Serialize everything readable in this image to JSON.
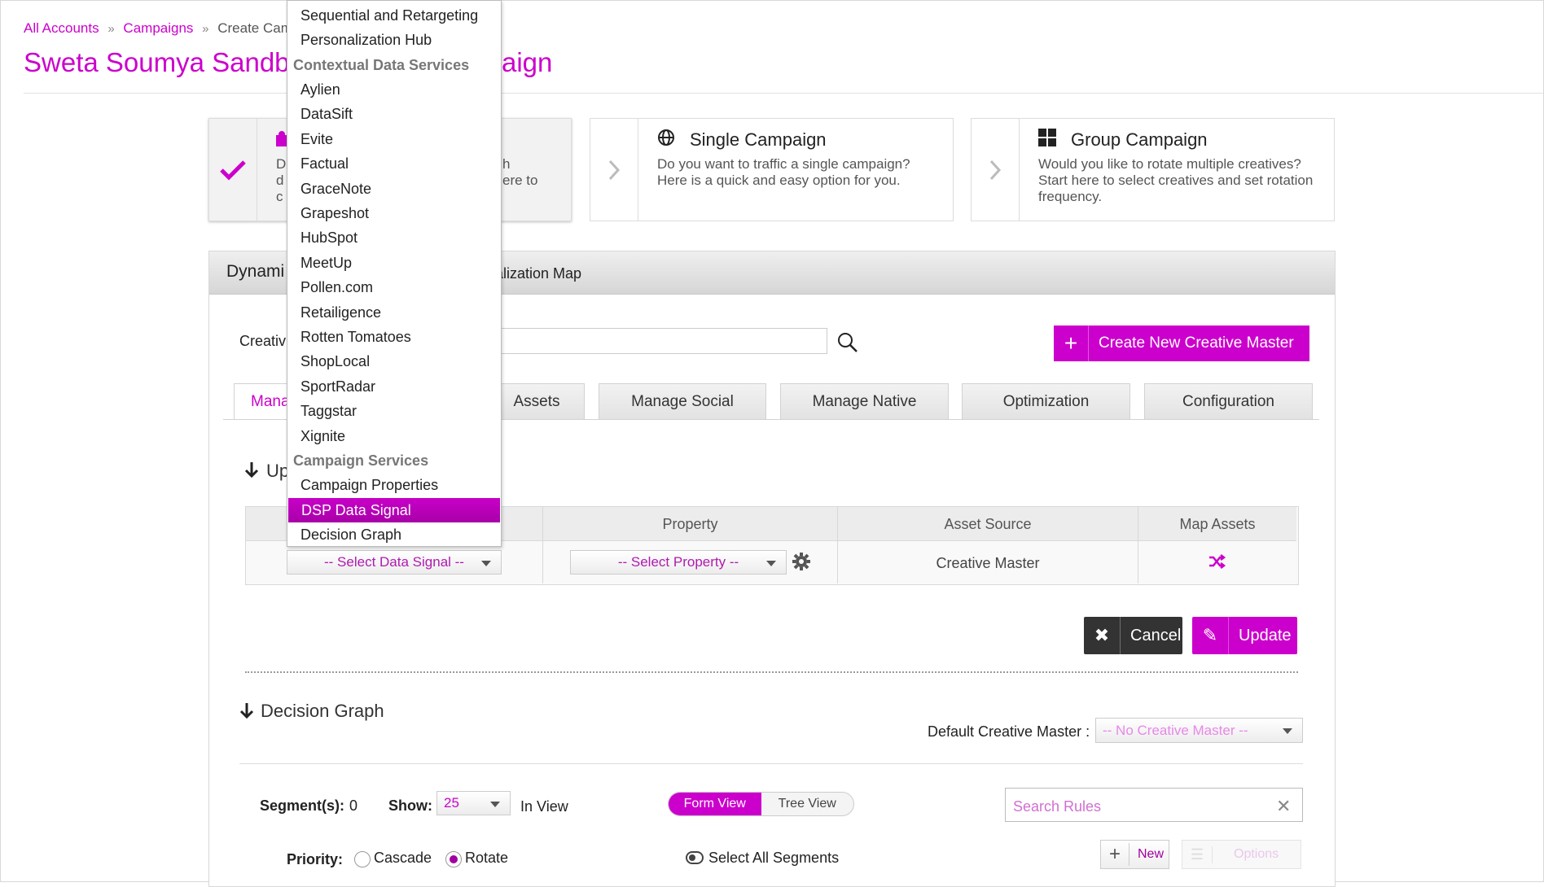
{
  "breadcrumb": {
    "items": [
      "All Accounts",
      "Campaigns",
      "Create Camp"
    ],
    "separator": "»"
  },
  "page": {
    "title_left": "Sweta Soumya Sandb",
    "title_right": "aign"
  },
  "cards": [
    {
      "title": "",
      "desc_left": [
        "D",
        "d",
        "c"
      ],
      "desc_right": [
        "h",
        "ere to",
        ""
      ],
      "icon": "puzzle-icon",
      "state": "checked"
    },
    {
      "title": "Single Campaign",
      "desc": "Do you want to traffic a single campaign? Here is a quick and easy option for you.",
      "icon": "globe-icon"
    },
    {
      "title": "Group Campaign",
      "desc": "Would you like to rotate multiple creatives? Start here to select creatives and set rotation frequency.",
      "icon": "grid-icon"
    }
  ],
  "panel": {
    "title_partial": "Dynami",
    "subtitle_partial": "nalization Map",
    "creative_label_partial": "Creativ",
    "create_button": "Create New Creative Master"
  },
  "tabs": [
    {
      "label": "Mana",
      "active": true
    },
    {
      "label": "Assets"
    },
    {
      "label": "Manage Social"
    },
    {
      "label": "Manage Native"
    },
    {
      "label": "Optimization"
    },
    {
      "label": "Configuration"
    }
  ],
  "update_section": {
    "heading_partial": "Up"
  },
  "map_table": {
    "headers": [
      "Property",
      "Asset Source",
      "Map Assets"
    ],
    "data_signal_placeholder": "-- Select Data Signal --",
    "property_placeholder": "-- Select Property --",
    "asset_source": "Creative Master"
  },
  "buttons": {
    "cancel": "Cancel",
    "update": "Update"
  },
  "decision_graph": {
    "heading": "Decision Graph",
    "default_label": "Default Creative Master :",
    "default_value": "-- No Creative Master --",
    "segments_label": "Segment(s):",
    "segments_value": "0",
    "show_label": "Show:",
    "show_value": "25",
    "in_view": "In View",
    "form_view": "Form View",
    "tree_view": "Tree View",
    "search_placeholder": "Search Rules",
    "priority_label": "Priority:",
    "priority_options": [
      "Cascade",
      "Rotate"
    ],
    "priority_selected": "Rotate",
    "select_all": "Select All Segments",
    "new_button": "New",
    "options_button": "Options"
  },
  "dropdown": {
    "top_items": [
      "Sequential and Retargeting",
      "Personalization Hub"
    ],
    "groups": [
      {
        "label": "Contextual Data Services",
        "items": [
          "Aylien",
          "DataSift",
          "Evite",
          "Factual",
          "GraceNote",
          "Grapeshot",
          "HubSpot",
          "MeetUp",
          "Pollen.com",
          "Retailigence",
          "Rotten Tomatoes",
          "ShopLocal",
          "SportRadar",
          "Taggstar",
          "Xignite"
        ]
      },
      {
        "label": "Campaign Services",
        "items": [
          "Campaign Properties",
          "DSP Data Signal",
          "Decision Graph"
        ]
      }
    ],
    "selected": "DSP Data Signal"
  },
  "colors": {
    "accent": "#cc00cc",
    "dark_button": "#333333"
  }
}
